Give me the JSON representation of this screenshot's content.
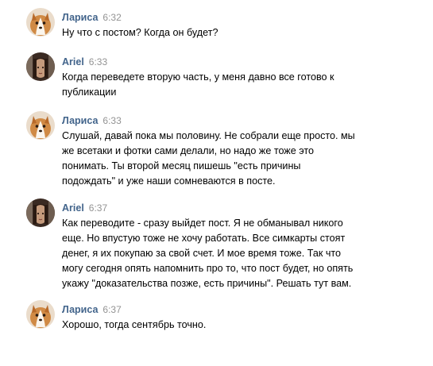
{
  "messages": [
    {
      "author": "Лариса",
      "time": "6:32",
      "avatar_icon": "corgi-puppy-avatar",
      "lines": [
        "Ну что с постом? Когда он будет?"
      ]
    },
    {
      "author": "Ariel",
      "time": "6:33",
      "avatar_icon": "portrait-avatar",
      "lines": [
        "Когда переведете вторую часть, у меня давно все готово к",
        "публикации"
      ]
    },
    {
      "author": "Лариса",
      "time": "6:33",
      "avatar_icon": "corgi-puppy-avatar",
      "lines": [
        "Слушай, давай пока мы половину. Не собрали еще просто. мы",
        "же всетаки и фотки сами делали, но надо же тоже это",
        "понимать. Ты второй месяц пишешь \"есть причины",
        "подождать\" и уже наши сомневаются в посте."
      ]
    },
    {
      "author": "Ariel",
      "time": "6:37",
      "avatar_icon": "portrait-avatar",
      "lines": [
        "Как переводите - сразу выйдет пост. Я не обманывал никого",
        "еще. Но впустую тоже не хочу работать. Все симкарты стоят",
        "денег, я их покупаю за свой счет. И мое время тоже. Так что",
        "могу сегодня опять напомнить про то, что пост будет, но опять",
        "укажу \"доказательства позже, есть причины\". Решать тут вам."
      ]
    },
    {
      "author": "Лариса",
      "time": "6:37",
      "avatar_icon": "corgi-puppy-avatar",
      "lines": [
        "Хорошо, тогда сентябрь точно."
      ]
    }
  ],
  "colors": {
    "author_name": "#42648b",
    "timestamp": "#939393",
    "message_text": "#000000",
    "background": "#ffffff"
  }
}
